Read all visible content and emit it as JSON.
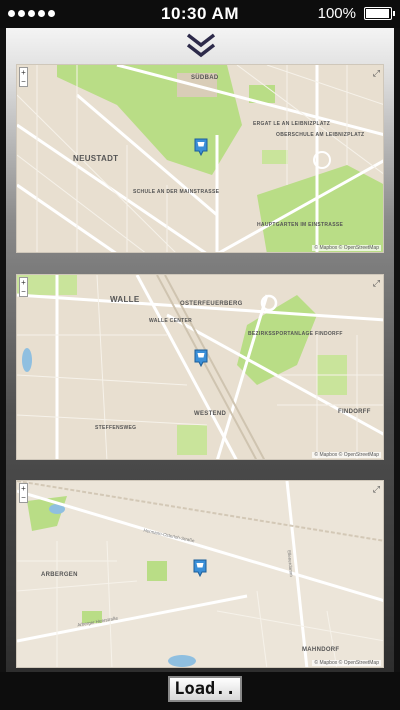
{
  "status": {
    "time": "10:30 AM",
    "battery_label": "100%",
    "battery_level": 1.0
  },
  "colors": {
    "park": "#b9dd86",
    "road": "#ffffff",
    "block": "#e6dccd",
    "water": "#8fbfe0",
    "pin": "#3a8fd8"
  },
  "icons": {
    "collapse": "double-chevron-down-icon",
    "pin": "shop-marker-icon",
    "fullscreen": "fullscreen-icon"
  },
  "maps": [
    {
      "attribution": "© Mapbox © OpenStreetMap",
      "labels": {
        "district": "NEUSTADT",
        "south": "SÜDBAD",
        "school1": "SCHULE AN DER MAINSTRASSE",
        "school2": "ERGAT LE AN LEIBNIZPLATZ",
        "school3": "OBERSCHULE AM LEIBNIZPLATZ",
        "school4": "HAUPTGARTEN IM EINSTRASSE"
      }
    },
    {
      "attribution": "© Mapbox © OpenStreetMap",
      "labels": {
        "walle": "WALLE",
        "walle_center": "WALLE CENTER",
        "osterfeuerberg": "OSTERFEUERBERG",
        "sport": "BEZIRKSSPORTANLAGE FINDORFF",
        "westend": "WESTEND",
        "steffensweg": "STEFFENSWEG",
        "findorff": "FINDORFF"
      }
    },
    {
      "attribution": "© Mapbox © OpenStreetMap",
      "labels": {
        "arbergen": "ARBERGEN",
        "mahndorf": "MAHNDORF",
        "street1": "Hermann-Osterloh-Straße",
        "street2": "Arberger Heerstraße",
        "street3": "Ellenerdamm"
      }
    }
  ],
  "load_button": "Load.."
}
